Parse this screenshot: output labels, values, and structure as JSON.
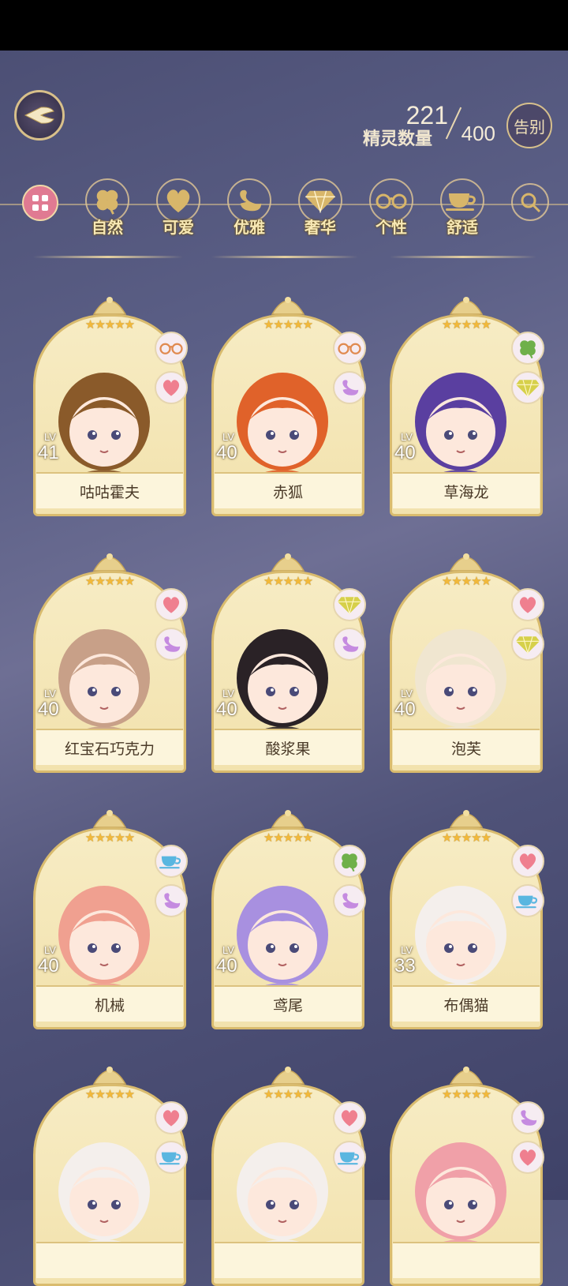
{
  "header": {
    "count_current": "221",
    "count_label": "精灵数量",
    "count_max": "400",
    "farewell_label": "告别"
  },
  "filters": [
    {
      "label": "",
      "icon": "grid-icon"
    },
    {
      "label": "自然",
      "icon": "clover-icon"
    },
    {
      "label": "可爱",
      "icon": "heart-icon"
    },
    {
      "label": "优雅",
      "icon": "swan-icon"
    },
    {
      "label": "奢华",
      "icon": "diamond-icon"
    },
    {
      "label": "个性",
      "icon": "glasses-icon"
    },
    {
      "label": "舒适",
      "icon": "teacup-icon"
    },
    {
      "label": "",
      "icon": "search-icon"
    }
  ],
  "cards": [
    {
      "name": "咕咕霍夫",
      "lv_label": "LV",
      "level": "41",
      "tags": [
        "glasses-icon",
        "heart-icon"
      ],
      "hair": "#8a5a2a"
    },
    {
      "name": "赤狐",
      "lv_label": "LV",
      "level": "40",
      "tags": [
        "glasses-icon",
        "swan-icon"
      ],
      "hair": "#e0622a"
    },
    {
      "name": "草海龙",
      "lv_label": "LV",
      "level": "40",
      "tags": [
        "clover-icon",
        "diamond-icon"
      ],
      "hair": "#5a3fa0"
    },
    {
      "name": "红宝石巧克力",
      "lv_label": "LV",
      "level": "40",
      "tags": [
        "heart-icon",
        "swan-icon"
      ],
      "hair": "#c8a088"
    },
    {
      "name": "酸浆果",
      "lv_label": "LV",
      "level": "40",
      "tags": [
        "diamond-icon",
        "swan-icon"
      ],
      "hair": "#2a2226"
    },
    {
      "name": "泡芙",
      "lv_label": "LV",
      "level": "40",
      "tags": [
        "heart-icon",
        "diamond-icon"
      ],
      "hair": "#f0e6d0"
    },
    {
      "name": "机械",
      "lv_label": "LV",
      "level": "40",
      "tags": [
        "teacup-icon",
        "swan-icon"
      ],
      "hair": "#f0a090"
    },
    {
      "name": "鸢尾",
      "lv_label": "LV",
      "level": "40",
      "tags": [
        "clover-icon",
        "swan-icon"
      ],
      "hair": "#a890e0"
    },
    {
      "name": "布偶猫",
      "lv_label": "LV",
      "level": "33",
      "tags": [
        "heart-icon",
        "teacup-icon"
      ],
      "hair": "#f4efec"
    },
    {
      "name": "",
      "lv_label": "",
      "level": "",
      "tags": [
        "heart-icon",
        "teacup-icon"
      ],
      "hair": "#f4efec"
    },
    {
      "name": "",
      "lv_label": "",
      "level": "",
      "tags": [
        "heart-icon",
        "teacup-icon"
      ],
      "hair": "#f4efec"
    },
    {
      "name": "",
      "lv_label": "",
      "level": "",
      "tags": [
        "swan-icon",
        "heart-icon"
      ],
      "hair": "#f0a0a8"
    }
  ],
  "colors": {
    "accent": "#d9bb6e",
    "name_text": "#4a3a28",
    "star": "#f2b93a"
  }
}
